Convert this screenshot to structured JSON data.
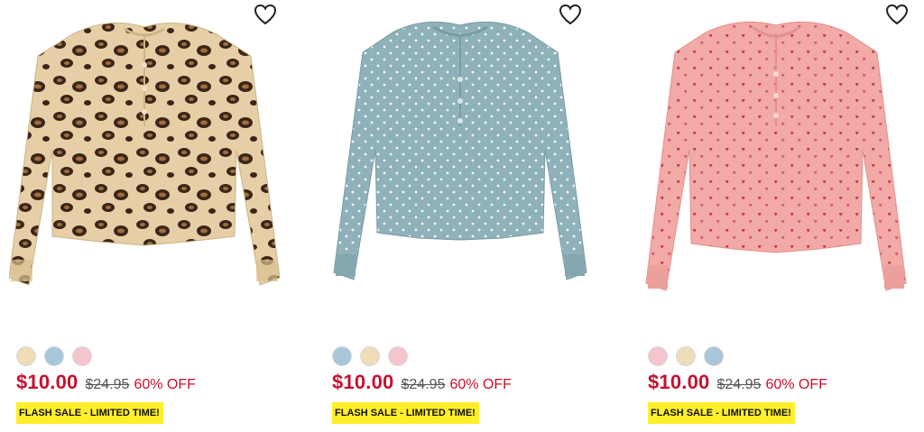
{
  "products": [
    {
      "image_alt": "Leopard print waffle henley top",
      "swatches": [
        "#efdcb9",
        "#a9c7da",
        "#f4c5cc"
      ],
      "sale_price": "$10.00",
      "original_price": "$24.95",
      "discount": "60% OFF",
      "badge": "FLASH SALE - LIMITED TIME!"
    },
    {
      "image_alt": "Blue polka dot waffle henley top",
      "swatches": [
        "#a9c7da",
        "#efdcb9",
        "#f4c5cc"
      ],
      "sale_price": "$10.00",
      "original_price": "$24.95",
      "discount": "60% OFF",
      "badge": "FLASH SALE - LIMITED TIME!"
    },
    {
      "image_alt": "Pink heart print waffle henley top",
      "swatches": [
        "#f4c5cc",
        "#efdcb9",
        "#a9c7da"
      ],
      "sale_price": "$10.00",
      "original_price": "$24.95",
      "discount": "60% OFF",
      "badge": "FLASH SALE - LIMITED TIME!"
    }
  ],
  "colors": {
    "sale_red": "#c8102e",
    "badge_yellow": "#ffef2b",
    "leopard_base": "#e6cfa6",
    "blue_base": "#8fb1b9",
    "pink_base": "#f2aaa7"
  },
  "icons": {
    "wishlist": "heart-outline-icon"
  }
}
